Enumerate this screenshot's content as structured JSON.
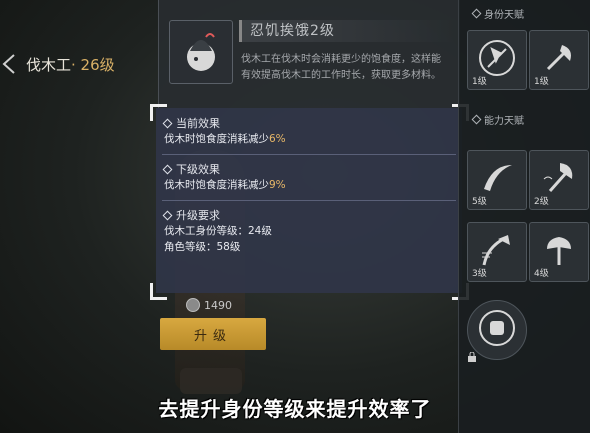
{
  "character": {
    "job": "伐木工",
    "level_label": "· 26级"
  },
  "talent": {
    "title": "忍饥挨饿2级",
    "description": "伐木工在伐木时会消耗更少的饱食度，这样能有效提高伐木工的工作时长，获取更多材料。"
  },
  "tooltip": {
    "current": {
      "heading": "当前效果",
      "text": "伐木时饱食度消耗减少",
      "value": "6%"
    },
    "next": {
      "heading": "下级效果",
      "text": "伐木时饱食度消耗减少",
      "value": "9%"
    },
    "requirements": {
      "heading": "升级要求",
      "lines": [
        "伐木工身份等级：24级",
        "角色等级：58级"
      ]
    }
  },
  "cost": {
    "amount": "1490",
    "icon": "coin-icon"
  },
  "upgrade_button": {
    "label": "升级"
  },
  "right_panel": {
    "identity_section": "身份天赋",
    "ability_section": "能力天赋",
    "slots": [
      {
        "icon": "axe-cross-icon",
        "level": "1级"
      },
      {
        "icon": "axe-icon",
        "level": "1级"
      },
      {
        "icon": "slash-icon",
        "level": "5级"
      },
      {
        "icon": "axe-swing-icon",
        "level": "2级"
      },
      {
        "icon": "axe-chop-icon",
        "level": "3级"
      },
      {
        "icon": "axe-heavy-icon",
        "level": "4级"
      },
      {
        "icon": "fist-icon",
        "level": ""
      }
    ]
  },
  "subtitle": "去提升身份等级来提升效率了",
  "colors": {
    "highlight": "#e8b868",
    "button": "#d8a840"
  }
}
